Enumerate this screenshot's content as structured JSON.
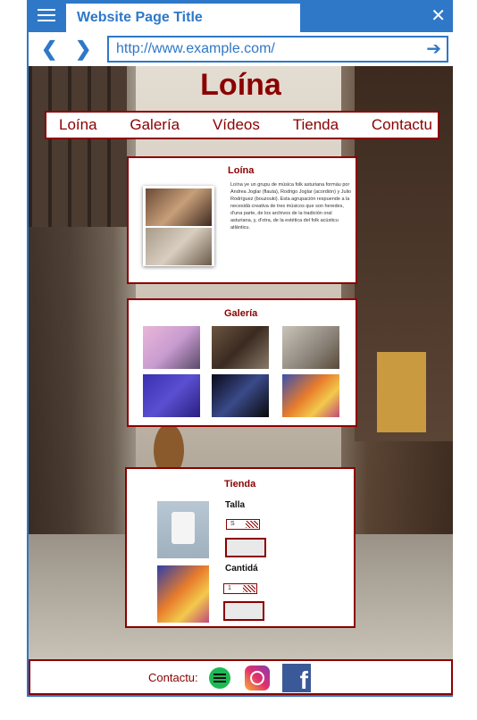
{
  "browser": {
    "tab_title": "Website Page Title",
    "url": "http://www.example.com/",
    "close_glyph": "✕",
    "back_glyph": "❮",
    "forward_glyph": "❯",
    "go_glyph": "➔"
  },
  "site": {
    "title": "Loína",
    "nav": [
      "Loína",
      "Galería",
      "Vídeos",
      "Tienda",
      "Contactu"
    ]
  },
  "about": {
    "title": "Loína",
    "text": "Loína ye un grupu de música folk asturiana formáu por Andrea Joglar (flauta), Rodrigo Joglar (acordión) y Julio Rodríguez (bouzouki). Esta agrupación respuende a la necesidá creativa de tres músicos que son heredes, d'una parte, de los archivos de la tradición oral asturiana, y, d'otra, de la estética del folk acústicu atlánticu."
  },
  "gallery": {
    "title": "Galería"
  },
  "shop": {
    "title": "Tienda",
    "size_label": "Talla",
    "size_value": "S",
    "quantity_label": "Cantidá",
    "quantity_value": "1"
  },
  "footer": {
    "contact_label": "Contactu:",
    "fb_glyph": "f"
  },
  "colors": {
    "browser_accent": "#2e78c7",
    "brand": "#8b0000"
  }
}
